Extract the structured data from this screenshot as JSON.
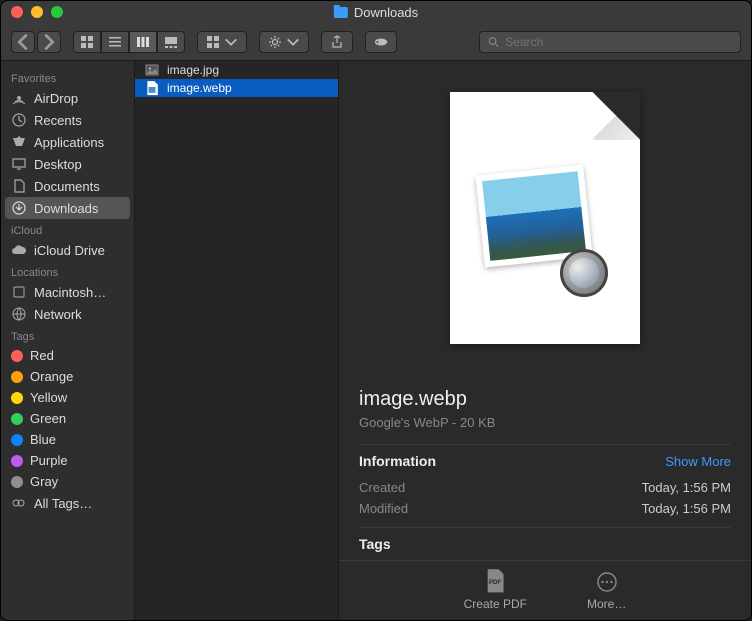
{
  "window": {
    "title": "Downloads"
  },
  "search": {
    "placeholder": "Search"
  },
  "sidebar": {
    "sections": [
      {
        "label": "Favorites",
        "items": [
          {
            "label": "AirDrop",
            "icon": "airdrop"
          },
          {
            "label": "Recents",
            "icon": "recents"
          },
          {
            "label": "Applications",
            "icon": "applications"
          },
          {
            "label": "Desktop",
            "icon": "desktop"
          },
          {
            "label": "Documents",
            "icon": "documents"
          },
          {
            "label": "Downloads",
            "icon": "downloads",
            "active": true
          }
        ]
      },
      {
        "label": "iCloud",
        "items": [
          {
            "label": "iCloud Drive",
            "icon": "icloud"
          }
        ]
      },
      {
        "label": "Locations",
        "items": [
          {
            "label": "Macintosh…",
            "icon": "disk"
          },
          {
            "label": "Network",
            "icon": "network"
          }
        ]
      },
      {
        "label": "Tags",
        "items": [
          {
            "label": "Red",
            "color": "#ff5f56"
          },
          {
            "label": "Orange",
            "color": "#ff9f0a"
          },
          {
            "label": "Yellow",
            "color": "#ffd60a"
          },
          {
            "label": "Green",
            "color": "#30d158"
          },
          {
            "label": "Blue",
            "color": "#0a84ff"
          },
          {
            "label": "Purple",
            "color": "#bf5af2"
          },
          {
            "label": "Gray",
            "color": "#8e8e93"
          },
          {
            "label": "All Tags…",
            "icon": "alltags"
          }
        ]
      }
    ]
  },
  "files": [
    {
      "name": "image.jpg",
      "icon": "jpg"
    },
    {
      "name": "image.webp",
      "icon": "webp",
      "selected": true
    }
  ],
  "preview": {
    "filename": "image.webp",
    "subtitle": "Google's WebP - 20 KB",
    "info_label": "Information",
    "show_more": "Show More",
    "rows": [
      {
        "label": "Created",
        "value": "Today, 1:56 PM"
      },
      {
        "label": "Modified",
        "value": "Today, 1:56 PM"
      }
    ],
    "tags_label": "Tags"
  },
  "actions": {
    "create_pdf": "Create PDF",
    "more": "More…"
  }
}
